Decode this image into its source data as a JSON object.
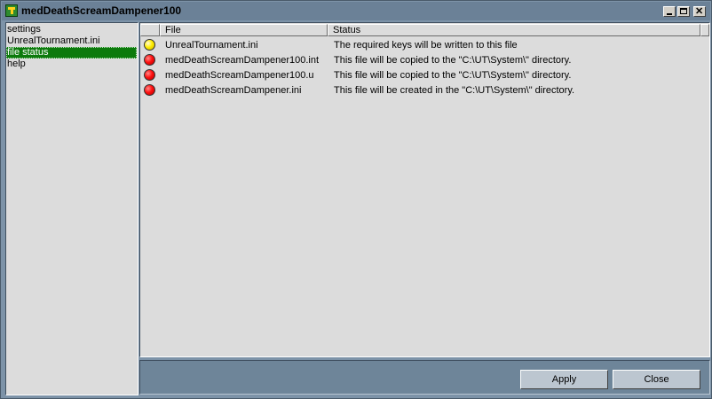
{
  "window": {
    "title": "medDeathScreamDampener100"
  },
  "nav": {
    "items": [
      {
        "label": "settings",
        "selected": false
      },
      {
        "label": "UnrealTournament.ini",
        "selected": false
      },
      {
        "label": "file status",
        "selected": true
      },
      {
        "label": "help",
        "selected": false
      }
    ]
  },
  "table": {
    "headers": {
      "file": "File",
      "status": "Status"
    },
    "rows": [
      {
        "icon": "yellow-circle-icon",
        "file": "UnrealTournament.ini",
        "status": "The required keys will be written to this file"
      },
      {
        "icon": "red-circle-icon",
        "file": "medDeathScreamDampener100.int",
        "status": "This file will be copied to the \"C:\\UT\\System\\\" directory."
      },
      {
        "icon": "red-circle-icon",
        "file": "medDeathScreamDampener100.u",
        "status": "This file will be copied to the \"C:\\UT\\System\\\" directory."
      },
      {
        "icon": "red-circle-icon",
        "file": "medDeathScreamDampener.ini",
        "status": "This file will be created in the \"C:\\UT\\System\\\" directory."
      }
    ]
  },
  "buttons": {
    "apply": "Apply",
    "close": "Close"
  },
  "colors": {
    "selection": "#0c7a0c",
    "window_bg": "#7d93a8",
    "panel_bg": "#dcdcdc"
  }
}
